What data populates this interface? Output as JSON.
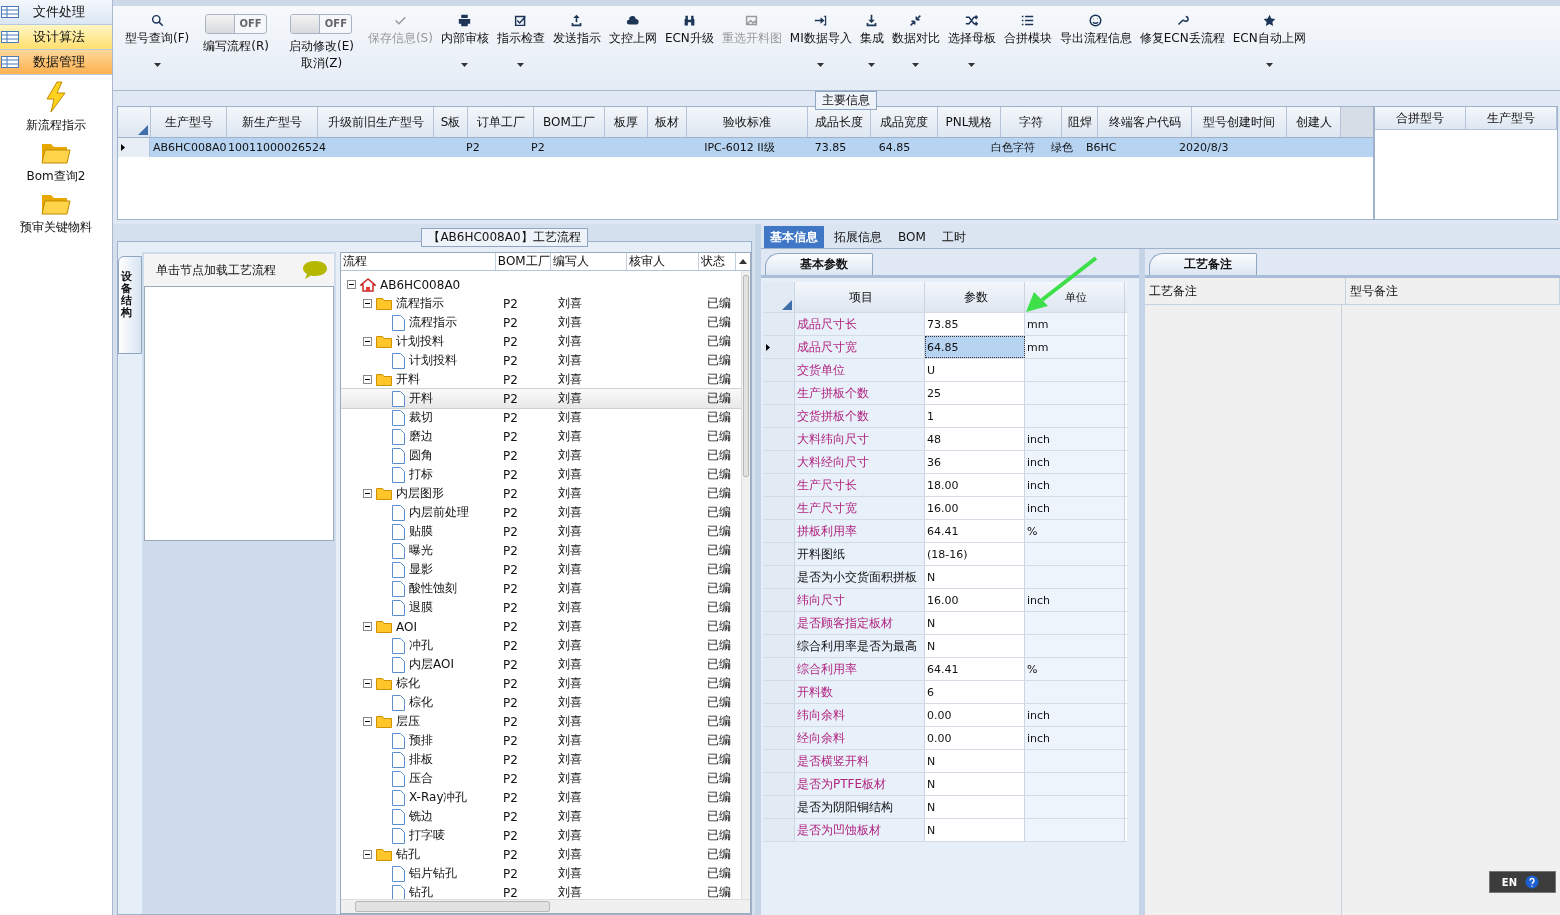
{
  "sidebar": {
    "menu": [
      {
        "label": "文件处理",
        "selected": false,
        "hover": false
      },
      {
        "label": "设计算法",
        "selected": false,
        "hover": true
      },
      {
        "label": "数据管理",
        "selected": true,
        "hover": false
      }
    ],
    "shortcuts": [
      {
        "label": "新流程指示",
        "kind": "lightning"
      },
      {
        "label": "Bom查询2",
        "kind": "folder"
      },
      {
        "label": "预审关键物料",
        "kind": "folder"
      }
    ]
  },
  "toolbar": [
    {
      "kind": "button",
      "label": "型号查询(F)",
      "dropdown": true,
      "disabled": false
    },
    {
      "kind": "toggle",
      "switch_text": "OFF",
      "on": false,
      "label": "编写流程(R)",
      "dropdown": false,
      "disabled": false
    },
    {
      "kind": "toggle",
      "switch_text": "OFF",
      "on": false,
      "label": "启动修改(E)\n取消(Z)",
      "dropdown": false,
      "disabled": false
    },
    {
      "kind": "button",
      "label": "保存信息(S)",
      "dropdown": false,
      "disabled": true
    },
    {
      "kind": "button",
      "label": "内部审核",
      "dropdown": true,
      "disabled": false
    },
    {
      "kind": "button",
      "label": "指示检查",
      "dropdown": true,
      "disabled": false
    },
    {
      "kind": "button",
      "label": "发送指示",
      "dropdown": false,
      "disabled": false
    },
    {
      "kind": "button",
      "label": "文控上网",
      "dropdown": false,
      "disabled": false
    },
    {
      "kind": "button",
      "label": "ECN升级",
      "dropdown": false,
      "disabled": false
    },
    {
      "kind": "button",
      "label": "重选开料图",
      "dropdown": false,
      "disabled": true
    },
    {
      "kind": "button",
      "label": "MI数据导入",
      "dropdown": true,
      "disabled": false
    },
    {
      "kind": "button",
      "label": "集成",
      "dropdown": true,
      "disabled": false
    },
    {
      "kind": "button",
      "label": "数据对比",
      "dropdown": true,
      "disabled": false
    },
    {
      "kind": "button",
      "label": "选择母板",
      "dropdown": true,
      "disabled": false
    },
    {
      "kind": "button",
      "label": "合拼模块",
      "dropdown": false,
      "disabled": false
    },
    {
      "kind": "button",
      "label": "导出流程信息",
      "dropdown": false,
      "disabled": false
    },
    {
      "kind": "button",
      "label": "修复ECN丢流程",
      "dropdown": false,
      "disabled": false
    },
    {
      "kind": "button",
      "label": "ECN自动上网",
      "dropdown": true,
      "disabled": false
    }
  ],
  "main_info": {
    "title": "主要信息",
    "columns": [
      "生产型号",
      "新生产型号",
      "升级前旧生产型号",
      "S板",
      "订单工厂",
      "BOM工厂",
      "板厚",
      "板材",
      "验收标准",
      "成品长度",
      "成品宽度",
      "PNL规格",
      "字符",
      "阻焊",
      "终端客户代码",
      "型号创建时间",
      "创建人"
    ],
    "rows": [
      {
        "selected": true,
        "cells": [
          "AB6HC008A0",
          "10011000026524",
          null,
          null,
          "P2",
          "P2",
          null,
          null,
          "IPC-6012 II级",
          "73.85",
          "64.85",
          null,
          "白色字符",
          "绿色",
          "B6HC",
          "2020/8/3",
          null
        ]
      }
    ],
    "side_columns": [
      "合拼型号",
      "生产型号"
    ]
  },
  "process": {
    "title": "【AB6HC008A0】工艺流程",
    "side_tab": "设备结构",
    "hint": "单击节点加载工艺流程",
    "columns": [
      "流程",
      "BOM工厂",
      "编写人",
      "核审人",
      "状态"
    ],
    "tree": [
      {
        "label": "AB6HC008A0",
        "kind": "root",
        "expanded": true,
        "selected": false,
        "children": [
          {
            "label": "流程指示",
            "bom": "P2",
            "writer": "刘喜",
            "status": "已编",
            "expanded": true,
            "selected": false,
            "children": [
              {
                "label": "流程指示",
                "bom": "P2",
                "writer": "刘喜",
                "status": "已编",
                "selected": false
              }
            ]
          },
          {
            "label": "计划投料",
            "bom": "P2",
            "writer": "刘喜",
            "status": "已编",
            "expanded": true,
            "selected": false,
            "children": [
              {
                "label": "计划投料",
                "bom": "P2",
                "writer": "刘喜",
                "status": "已编",
                "selected": false
              }
            ]
          },
          {
            "label": "开料",
            "bom": "P2",
            "writer": "刘喜",
            "status": "已编",
            "expanded": true,
            "selected": false,
            "children": [
              {
                "label": "开料",
                "bom": "P2",
                "writer": "刘喜",
                "status": "已编",
                "selected": true
              },
              {
                "label": "裁切",
                "bom": "P2",
                "writer": "刘喜",
                "status": "已编",
                "selected": false
              },
              {
                "label": "磨边",
                "bom": "P2",
                "writer": "刘喜",
                "status": "已编",
                "selected": false
              },
              {
                "label": "圆角",
                "bom": "P2",
                "writer": "刘喜",
                "status": "已编",
                "selected": false
              },
              {
                "label": "打标",
                "bom": "P2",
                "writer": "刘喜",
                "status": "已编",
                "selected": false
              }
            ]
          },
          {
            "label": "内层图形",
            "bom": "P2",
            "writer": "刘喜",
            "status": "已编",
            "expanded": true,
            "selected": false,
            "children": [
              {
                "label": "内层前处理",
                "bom": "P2",
                "writer": "刘喜",
                "status": "已编",
                "selected": false
              },
              {
                "label": "贴膜",
                "bom": "P2",
                "writer": "刘喜",
                "status": "已编",
                "selected": false
              },
              {
                "label": "曝光",
                "bom": "P2",
                "writer": "刘喜",
                "status": "已编",
                "selected": false
              },
              {
                "label": "显影",
                "bom": "P2",
                "writer": "刘喜",
                "status": "已编",
                "selected": false
              },
              {
                "label": "酸性蚀刻",
                "bom": "P2",
                "writer": "刘喜",
                "status": "已编",
                "selected": false
              },
              {
                "label": "退膜",
                "bom": "P2",
                "writer": "刘喜",
                "status": "已编",
                "selected": false
              }
            ]
          },
          {
            "label": "AOI",
            "bom": "P2",
            "writer": "刘喜",
            "status": "已编",
            "expanded": true,
            "selected": false,
            "children": [
              {
                "label": "冲孔",
                "bom": "P2",
                "writer": "刘喜",
                "status": "已编",
                "selected": false
              },
              {
                "label": "内层AOI",
                "bom": "P2",
                "writer": "刘喜",
                "status": "已编",
                "selected": false
              }
            ]
          },
          {
            "label": "棕化",
            "bom": "P2",
            "writer": "刘喜",
            "status": "已编",
            "expanded": true,
            "selected": false,
            "children": [
              {
                "label": "棕化",
                "bom": "P2",
                "writer": "刘喜",
                "status": "已编",
                "selected": false
              }
            ]
          },
          {
            "label": "层压",
            "bom": "P2",
            "writer": "刘喜",
            "status": "已编",
            "expanded": true,
            "selected": false,
            "children": [
              {
                "label": "预排",
                "bom": "P2",
                "writer": "刘喜",
                "status": "已编",
                "selected": false
              },
              {
                "label": "排板",
                "bom": "P2",
                "writer": "刘喜",
                "status": "已编",
                "selected": false
              },
              {
                "label": "压合",
                "bom": "P2",
                "writer": "刘喜",
                "status": "已编",
                "selected": false
              },
              {
                "label": "X-Ray冲孔",
                "bom": "P2",
                "writer": "刘喜",
                "status": "已编",
                "selected": false
              },
              {
                "label": "铣边",
                "bom": "P2",
                "writer": "刘喜",
                "status": "已编",
                "selected": false
              },
              {
                "label": "打字唛",
                "bom": "P2",
                "writer": "刘喜",
                "status": "已编",
                "selected": false
              }
            ]
          },
          {
            "label": "钻孔",
            "bom": "P2",
            "writer": "刘喜",
            "status": "已编",
            "expanded": true,
            "selected": false,
            "children": [
              {
                "label": "铝片钻孔",
                "bom": "P2",
                "writer": "刘喜",
                "status": "已编",
                "selected": false
              },
              {
                "label": "钻孔",
                "bom": "P2",
                "writer": "刘喜",
                "status": "已编",
                "selected": false
              }
            ]
          }
        ]
      }
    ]
  },
  "detail_tabs": [
    {
      "label": "基本信息",
      "selected": true
    },
    {
      "label": "拓展信息",
      "selected": false
    },
    {
      "label": "BOM",
      "selected": false
    },
    {
      "label": "工时",
      "selected": false
    }
  ],
  "basic_params": {
    "title": "基本参数",
    "columns": [
      "项目",
      "参数",
      "单位"
    ],
    "rows": [
      {
        "name": "成品尺寸长",
        "value": "73.85",
        "unit": "mm",
        "emphasized": true,
        "selected": false
      },
      {
        "name": "成品尺寸宽",
        "value": "64.85",
        "unit": "mm",
        "emphasized": true,
        "selected": true
      },
      {
        "name": "交货单位",
        "value": "U",
        "emphasized": true,
        "selected": false
      },
      {
        "name": "生产拼板个数",
        "value": "25",
        "emphasized": true,
        "selected": false
      },
      {
        "name": "交货拼板个数",
        "value": "1",
        "emphasized": true,
        "selected": false
      },
      {
        "name": "大料纬向尺寸",
        "value": "48",
        "unit": "inch",
        "emphasized": true,
        "selected": false
      },
      {
        "name": "大料经向尺寸",
        "value": "36",
        "unit": "inch",
        "emphasized": true,
        "selected": false
      },
      {
        "name": "生产尺寸长",
        "value": "18.00",
        "unit": "inch",
        "emphasized": true,
        "selected": false
      },
      {
        "name": "生产尺寸宽",
        "value": "16.00",
        "unit": "inch",
        "emphasized": true,
        "selected": false
      },
      {
        "name": "拼板利用率",
        "value": "64.41",
        "unit": "%",
        "emphasized": true,
        "selected": false
      },
      {
        "name": "开料图纸",
        "value": "(18-16)",
        "emphasized": false,
        "selected": false
      },
      {
        "name": "是否为小交货面积拼板",
        "value": "N",
        "emphasized": false,
        "selected": false
      },
      {
        "name": "纬向尺寸",
        "value": "16.00",
        "unit": "inch",
        "emphasized": true,
        "selected": false
      },
      {
        "name": "是否顾客指定板材",
        "value": "N",
        "emphasized": true,
        "selected": false
      },
      {
        "name": "综合利用率是否为最高",
        "value": "N",
        "emphasized": false,
        "selected": false
      },
      {
        "name": "综合利用率",
        "value": "64.41",
        "unit": "%",
        "emphasized": true,
        "selected": false
      },
      {
        "name": "开料数",
        "value": "6",
        "emphasized": true,
        "selected": false
      },
      {
        "name": "纬向余料",
        "value": "0.00",
        "unit": "inch",
        "emphasized": true,
        "selected": false
      },
      {
        "name": "经向余料",
        "value": "0.00",
        "unit": "inch",
        "emphasized": true,
        "selected": false
      },
      {
        "name": "是否横竖开料",
        "value": "N",
        "emphasized": true,
        "selected": false
      },
      {
        "name": "是否为PTFE板材",
        "value": "N",
        "emphasized": true,
        "selected": false
      },
      {
        "name": "是否为阴阳铜结构",
        "value": "N",
        "emphasized": false,
        "selected": false
      },
      {
        "name": "是否为凹蚀板材",
        "value": "N",
        "emphasized": true,
        "selected": false
      }
    ]
  },
  "process_notes": {
    "title": "工艺备注",
    "columns": [
      "工艺备注",
      "型号备注"
    ]
  },
  "language_bar": {
    "label": "EN"
  }
}
